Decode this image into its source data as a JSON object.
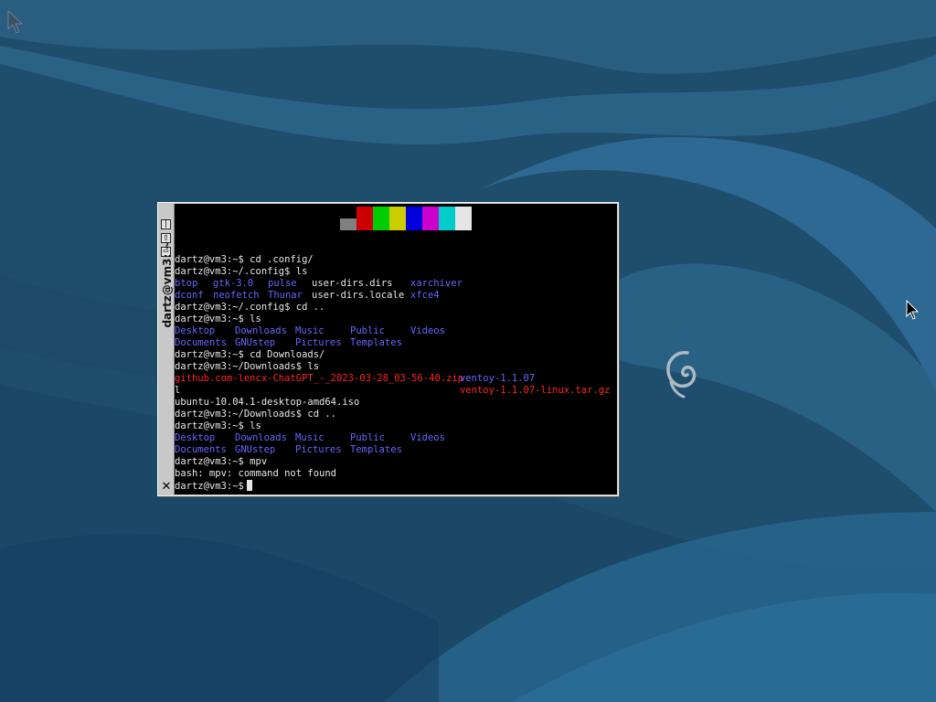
{
  "desktop": {
    "corner_icon": "desktop-corner-icon",
    "logo_icon": "debian-swirl-icon",
    "pointer_icon": "mouse-pointer-icon",
    "colors": {
      "background": "#1e4c6a",
      "wave_light": "#2f6f93",
      "wave_dark": "#163d57"
    }
  },
  "window": {
    "title": "dartz@vm3: ~",
    "buttons": [
      {
        "name": "iconify-button",
        "glyph": "|"
      },
      {
        "name": "maximize-button",
        "glyph": "▯"
      },
      {
        "name": "shade-button",
        "glyph": "▭"
      }
    ],
    "close_glyph": "✕"
  },
  "terminal": {
    "color_swatches": [
      {
        "color": "#808080",
        "row": "bottom"
      },
      {
        "color": "#cc0000",
        "row": "full"
      },
      {
        "color": "#00cc00",
        "row": "full"
      },
      {
        "color": "#cccc00",
        "row": "full"
      },
      {
        "color": "#0000dd",
        "row": "full"
      },
      {
        "color": "#cc00cc",
        "row": "full"
      },
      {
        "color": "#00cccc",
        "row": "full"
      },
      {
        "color": "#e5e5e5",
        "row": "full"
      }
    ],
    "lines": [
      {
        "segments": [
          {
            "text": "dartz@vm3:~$ cd .config/",
            "kind": "w",
            "col": 0
          }
        ]
      },
      {
        "segments": [
          {
            "text": "dartz@vm3:~/.config$ ls",
            "kind": "w",
            "col": 0
          }
        ]
      },
      {
        "segments": [
          {
            "text": "btop",
            "kind": "d",
            "col": 0
          },
          {
            "text": "gtk-3.0",
            "kind": "d",
            "col": 1
          },
          {
            "text": "pulse",
            "kind": "d",
            "col": 2
          },
          {
            "text": "user-dirs.dirs",
            "kind": "w",
            "col": 3
          },
          {
            "text": "xarchiver",
            "kind": "d",
            "col": 4
          }
        ]
      },
      {
        "segments": [
          {
            "text": "dconf",
            "kind": "d",
            "col": 0
          },
          {
            "text": "neofetch",
            "kind": "d",
            "col": 1
          },
          {
            "text": "Thunar",
            "kind": "d",
            "col": 2
          },
          {
            "text": "user-dirs.locale",
            "kind": "w",
            "col": 3
          },
          {
            "text": "xfce4",
            "kind": "d",
            "col": 4
          }
        ]
      },
      {
        "segments": [
          {
            "text": "dartz@vm3:~/.config$ cd ..",
            "kind": "w",
            "col": 0
          }
        ]
      },
      {
        "segments": [
          {
            "text": "dartz@vm3:~$ ls",
            "kind": "w",
            "col": 0
          }
        ]
      },
      {
        "segments": [
          {
            "text": "Desktop",
            "kind": "d",
            "col": 5
          },
          {
            "text": "Downloads",
            "kind": "d",
            "col": 6
          },
          {
            "text": "Music",
            "kind": "d",
            "col": 7
          },
          {
            "text": "Public",
            "kind": "d",
            "col": 8
          },
          {
            "text": "Videos",
            "kind": "d",
            "col": 9
          }
        ]
      },
      {
        "segments": [
          {
            "text": "Documents",
            "kind": "d",
            "col": 5
          },
          {
            "text": "GNUstep",
            "kind": "d",
            "col": 6
          },
          {
            "text": "Pictures",
            "kind": "d",
            "col": 7
          },
          {
            "text": "Templates",
            "kind": "d",
            "col": 8
          }
        ]
      },
      {
        "segments": [
          {
            "text": "dartz@vm3:~$ cd Downloads/",
            "kind": "w",
            "col": 0
          }
        ]
      },
      {
        "segments": [
          {
            "text": "dartz@vm3:~/Downloads$ ls",
            "kind": "w",
            "col": 0
          }
        ]
      },
      {
        "segments": [
          {
            "text": "github.com-lencx-ChatGPT_-_2023-03-28_03-56-40.zip",
            "kind": "r",
            "col": 0
          },
          {
            "text": "ventoy-1.1.07",
            "kind": "d",
            "col": 10
          }
        ]
      },
      {
        "segments": [
          {
            "text": "l",
            "kind": "w",
            "col": 0
          },
          {
            "text": "ventoy-1.1.07-linux.tar.gz",
            "kind": "r",
            "col": 10
          }
        ]
      },
      {
        "segments": [
          {
            "text": "ubuntu-10.04.1-desktop-amd64.iso",
            "kind": "w",
            "col": 0
          }
        ]
      },
      {
        "segments": [
          {
            "text": "dartz@vm3:~/Downloads$ cd ..",
            "kind": "w",
            "col": 0
          }
        ]
      },
      {
        "segments": [
          {
            "text": "dartz@vm3:~$ ls",
            "kind": "w",
            "col": 0
          }
        ]
      },
      {
        "segments": [
          {
            "text": "Desktop",
            "kind": "d",
            "col": 5
          },
          {
            "text": "Downloads",
            "kind": "d",
            "col": 6
          },
          {
            "text": "Music",
            "kind": "d",
            "col": 7
          },
          {
            "text": "Public",
            "kind": "d",
            "col": 8
          },
          {
            "text": "Videos",
            "kind": "d",
            "col": 9
          }
        ]
      },
      {
        "segments": [
          {
            "text": "Documents",
            "kind": "d",
            "col": 5
          },
          {
            "text": "GNUstep",
            "kind": "d",
            "col": 6
          },
          {
            "text": "Pictures",
            "kind": "d",
            "col": 7
          },
          {
            "text": "Templates",
            "kind": "d",
            "col": 8
          }
        ]
      },
      {
        "segments": [
          {
            "text": "dartz@vm3:~$ mpv",
            "kind": "w",
            "col": 0
          }
        ]
      },
      {
        "segments": [
          {
            "text": "bash: mpv: command not found",
            "kind": "w",
            "col": 0
          }
        ]
      },
      {
        "segments": [
          {
            "text": "dartz@vm3:~$",
            "kind": "w",
            "col": 0,
            "cursor": true
          }
        ]
      }
    ]
  }
}
